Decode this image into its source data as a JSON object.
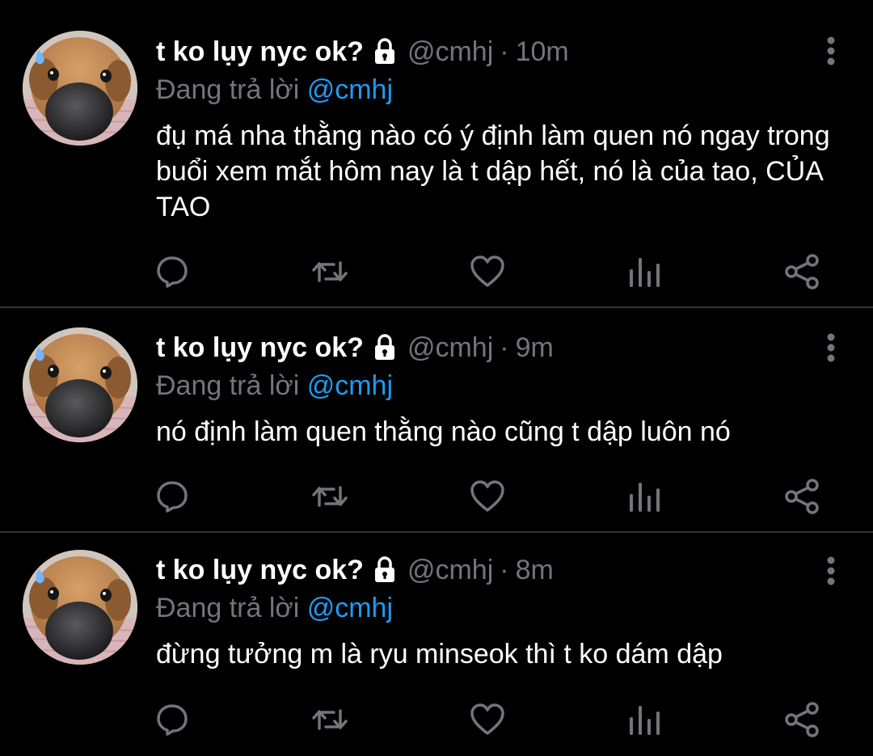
{
  "colors": {
    "background": "#000000",
    "text": "#ffffff",
    "secondary": "#71767b",
    "mention": "#1d9bf0",
    "divider": "#2f3336"
  },
  "tweets": [
    {
      "display_name": "t ko lụy nyc ok?",
      "handle": "@cmhj",
      "separator": "·",
      "time": "10m",
      "reply_prefix": "Đang trả lời",
      "reply_to": "@cmhj",
      "text": "đụ má nha thằng nào có ý định làm quen nó ngay trong buổi xem mắt hôm nay là t dập hết, nó là của tao, CỦA TAO",
      "icons": [
        "lock-icon",
        "more-icon",
        "reply-icon",
        "retweet-icon",
        "like-icon",
        "views-icon",
        "share-icon"
      ]
    },
    {
      "display_name": "t ko lụy nyc ok?",
      "handle": "@cmhj",
      "separator": "·",
      "time": "9m",
      "reply_prefix": "Đang trả lời",
      "reply_to": "@cmhj",
      "text": "nó định làm quen thằng nào cũng t dập luôn nó",
      "icons": [
        "lock-icon",
        "more-icon",
        "reply-icon",
        "retweet-icon",
        "like-icon",
        "views-icon",
        "share-icon"
      ]
    },
    {
      "display_name": "t ko lụy nyc ok?",
      "handle": "@cmhj",
      "separator": "·",
      "time": "8m",
      "reply_prefix": "Đang trả lời",
      "reply_to": "@cmhj",
      "text": "đừng tưởng m là ryu minseok thì t ko dám dập",
      "icons": [
        "lock-icon",
        "more-icon",
        "reply-icon",
        "retweet-icon",
        "like-icon",
        "views-icon",
        "share-icon"
      ]
    }
  ]
}
